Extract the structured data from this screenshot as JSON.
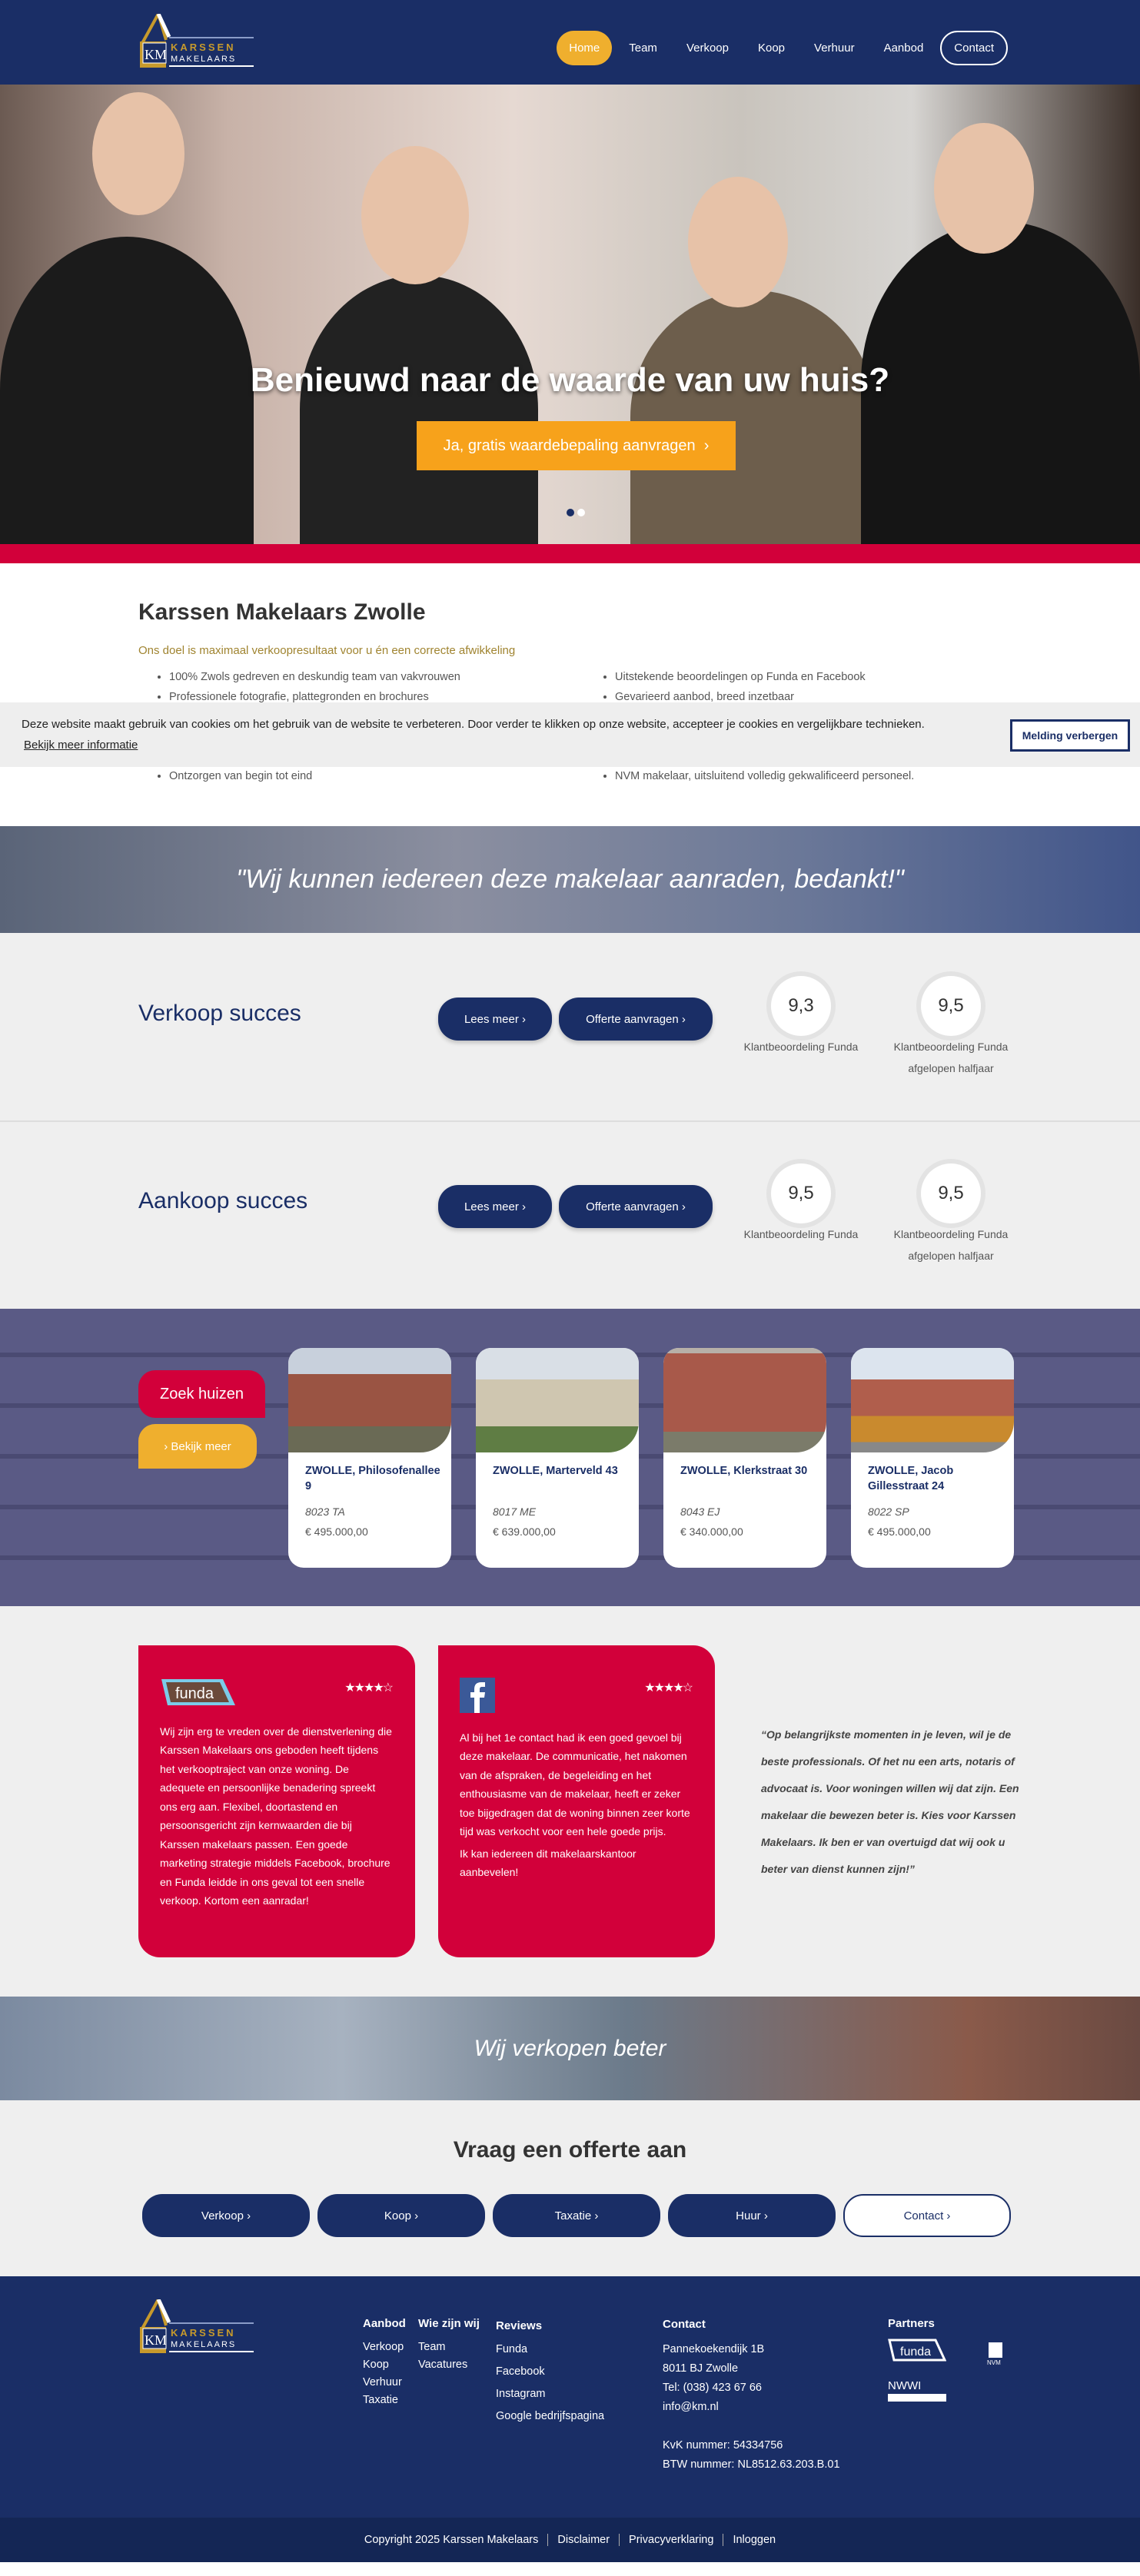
{
  "header": {
    "brand": "KARSSEN MAKELAARS",
    "brand_top": "KARSSEN",
    "brand_bottom": "MAKELAARS",
    "nav": [
      {
        "label": "Home",
        "active": true
      },
      {
        "label": "Team"
      },
      {
        "label": "Verkoop"
      },
      {
        "label": "Koop"
      },
      {
        "label": "Verhuur"
      },
      {
        "label": "Aanbod"
      },
      {
        "label": "Contact"
      }
    ]
  },
  "hero": {
    "title": "Benieuwd naar de waarde van uw huis?",
    "cta": "Ja, gratis waardebepaling aanvragen",
    "slides": 2,
    "active_slide": 1
  },
  "intro": {
    "title": "Karssen Makelaars Zwolle",
    "subtitle": "Ons doel is maximaal verkoopresultaat voor u én een correcte afwikkeling",
    "bullets_left": [
      "100% Zwols gedreven en deskundig team van vakvrouwen",
      "Professionele fotografie, plattegronden en brochures",
      "Ontzorgen van begin tot eind"
    ],
    "bullets_right": [
      "Uitstekende beoordelingen op Funda en Facebook",
      "Gevarieerd aanbod, breed inzetbaar",
      "NVM makelaar, uitsluitend volledig gekwalificeerd personeel."
    ]
  },
  "cookie": {
    "text": "Deze website maakt gebruik van cookies om het gebruik van de website te verbeteren. Door verder te klikken op onze website, accepteer je cookies en vergelijkbare technieken.",
    "link": "Bekijk meer informatie",
    "button": "Melding verbergen"
  },
  "quote_banner": "\"Wij kunnen iedereen deze makelaar aanraden, bedankt!\"",
  "success": [
    {
      "title": "Verkoop succes",
      "btn1": "Lees meer",
      "btn2": "Offerte aanvragen",
      "scores": [
        {
          "value": "9,3",
          "label": "Klantbeoordeling Funda"
        },
        {
          "value": "9,5",
          "label": "Klantbeoordeling Funda afgelopen halfjaar"
        }
      ]
    },
    {
      "title": "Aankoop succes",
      "btn1": "Lees meer",
      "btn2": "Offerte aanvragen",
      "scores": [
        {
          "value": "9,5",
          "label": "Klantbeoordeling Funda"
        },
        {
          "value": "9,5",
          "label": "Klantbeoordeling Funda afgelopen halfjaar"
        }
      ]
    }
  ],
  "houses": {
    "search": "Zoek huizen",
    "more": "Bekijk meer",
    "items": [
      {
        "title": "ZWOLLE, Philosofenallee 9",
        "postcode": "8023 TA",
        "price": "€ 495.000,00"
      },
      {
        "title": "ZWOLLE, Marterveld 43",
        "postcode": "8017 ME",
        "price": "€ 639.000,00"
      },
      {
        "title": "ZWOLLE, Klerkstraat 30",
        "postcode": "8043 EJ",
        "price": "€ 340.000,00"
      },
      {
        "title": "ZWOLLE, Jacob Gillesstraat 24",
        "postcode": "8022 SP",
        "price": "€ 495.000,00"
      }
    ]
  },
  "reviews": {
    "funda": {
      "logo": "funda",
      "rating": 4.5,
      "text": "Wij zijn erg te vreden over de dienstverlening die Karssen Makelaars ons geboden heeft tijdens het verkooptraject van onze woning. De adequete en persoonlijke benadering spreekt ons erg aan. Flexibel, doortastend en persoonsgericht zijn kernwaarden die bij Karssen makelaars passen. Een goede marketing strategie middels Facebook, brochure en Funda leidde in ons geval tot een snelle verkoop. Kortom een aanradar!"
    },
    "facebook": {
      "rating": 4.5,
      "text1": "Al bij het 1e contact had ik een goed gevoel bij deze makelaar. De communicatie, het nakomen van de afspraken, de begeleiding en het enthousiasme van de makelaar, heeft er zeker toe bijgedragen dat de woning binnen zeer korte tijd was verkocht voor een hele goede prijs.",
      "text2": "Ik kan iedereen dit makelaarskantoor aanbevelen!"
    },
    "quote": "“Op belangrijkste momenten in je leven, wil je de beste professionals. Of het nu een arts, notaris of advocaat is. Voor woningen willen wij dat zijn. Een makelaar die bewezen beter is. Kies voor Karssen Makelaars. Ik ben er van overtuigd dat wij ook u beter van dienst kunnen zijn!”"
  },
  "banner2": "Wij verkopen beter",
  "offer": {
    "title": "Vraag een offerte aan",
    "buttons": [
      "Verkoop",
      "Koop",
      "Taxatie",
      "Huur",
      "Contact"
    ]
  },
  "footer": {
    "aanbod": {
      "title": "Aanbod",
      "items": [
        "Verkoop",
        "Koop",
        "Verhuur",
        "Taxatie"
      ]
    },
    "wie": {
      "title": "Wie zijn wij",
      "items": [
        "Team",
        "Vacatures"
      ]
    },
    "reviews": {
      "title": "Reviews",
      "items": [
        "Funda",
        "Facebook",
        "Instagram",
        "Google bedrijfspagina"
      ]
    },
    "contact": {
      "title": "Contact",
      "lines": [
        "Pannekoekendijk 1B",
        "8011 BJ Zwolle",
        "Tel: (038) 423 67 66",
        "info@km.nl"
      ],
      "kvk": "KvK nummer: 54334756",
      "btw": "BTW nummer: NL8512.63.203.B.01"
    },
    "partners": {
      "title": "Partners",
      "items": [
        "funda",
        "NVM",
        "NWWI"
      ]
    }
  },
  "bottom": {
    "copyright": "Copyright 2025 Karssen Makelaars",
    "links": [
      "Disclaimer",
      "Privacyverklaring",
      "Inloggen"
    ]
  },
  "colors": {
    "navy": "#1a2e66",
    "red": "#d2003a",
    "gold": "#efaf2e",
    "orange": "#f7a21b"
  }
}
